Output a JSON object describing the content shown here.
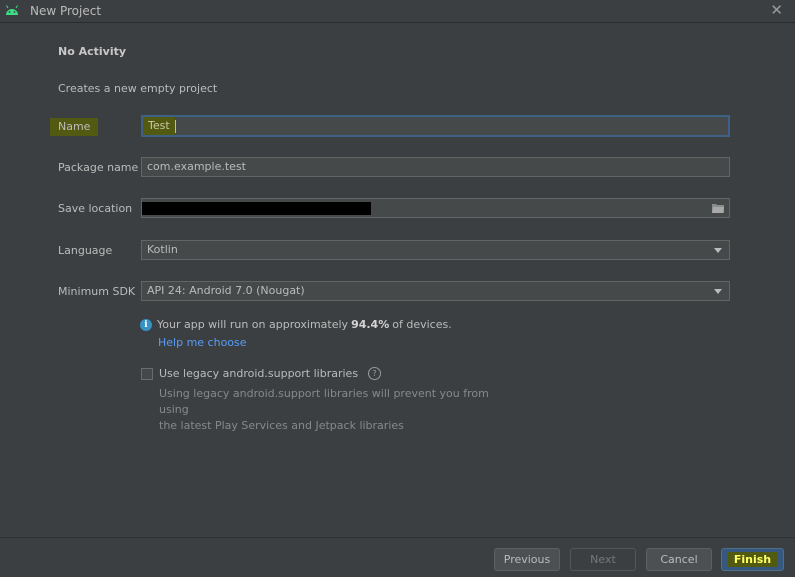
{
  "window": {
    "title": "New Project",
    "close_glyph": "✕",
    "icon": "android-icon"
  },
  "template": {
    "heading": "No Activity",
    "description": "Creates a new empty project"
  },
  "form": {
    "name_label": "Name",
    "name_value": "Test",
    "package_label": "Package name",
    "package_value": "com.example.test",
    "save_label": "Save location",
    "language_label": "Language",
    "language_value": "Kotlin",
    "sdk_label": "Minimum SDK",
    "sdk_value": "API 24: Android 7.0 (Nougat)"
  },
  "info": {
    "prefix": "Your app will run on approximately",
    "percent": "94.4%",
    "suffix": "of devices.",
    "help_link": "Help me choose"
  },
  "legacy": {
    "checkbox_label": "Use legacy android.support libraries",
    "checked": false,
    "hint_line1": "Using legacy android.support libraries will prevent you from using",
    "hint_line2": "the latest Play Services and Jetpack libraries"
  },
  "footer": {
    "previous": "Previous",
    "next": "Next",
    "cancel": "Cancel",
    "finish": "Finish"
  },
  "colors": {
    "background": "#3c3f41",
    "field_bg": "#45494a",
    "focus_border": "#3d6185",
    "highlight": "#525a12",
    "link": "#589df6",
    "info": "#3592c4",
    "default_button": "#365880"
  }
}
